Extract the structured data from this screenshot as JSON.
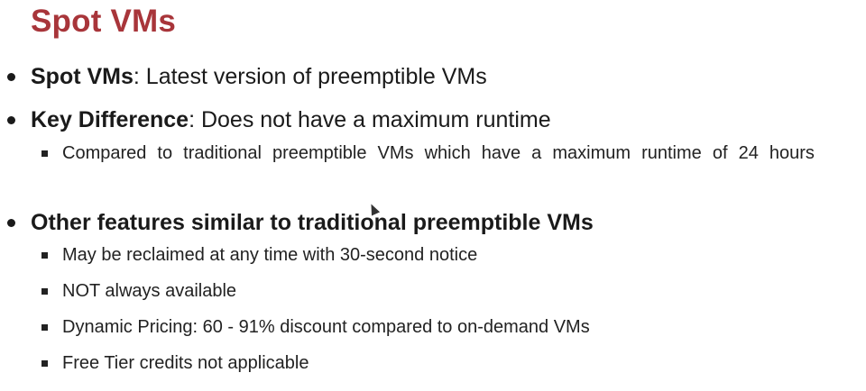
{
  "slide": {
    "title": "Spot VMs",
    "bullets": [
      {
        "label": "Spot VMs",
        "text": ": Latest version of preemptible VMs"
      },
      {
        "label": "Key Difference",
        "text": ": Does not have a maximum runtime",
        "sub": [
          "Compared to traditional preemptible VMs which have a maximum runtime of 24 hours"
        ]
      },
      {
        "label": "Other features similar to traditional preemptible VMs",
        "text": "",
        "sub": [
          "May be reclaimed at any time with 30-second notice",
          "NOT always available",
          "Dynamic Pricing: 60 - 91% discount compared to on-demand VMs",
          "Free Tier credits not applicable"
        ]
      }
    ]
  }
}
